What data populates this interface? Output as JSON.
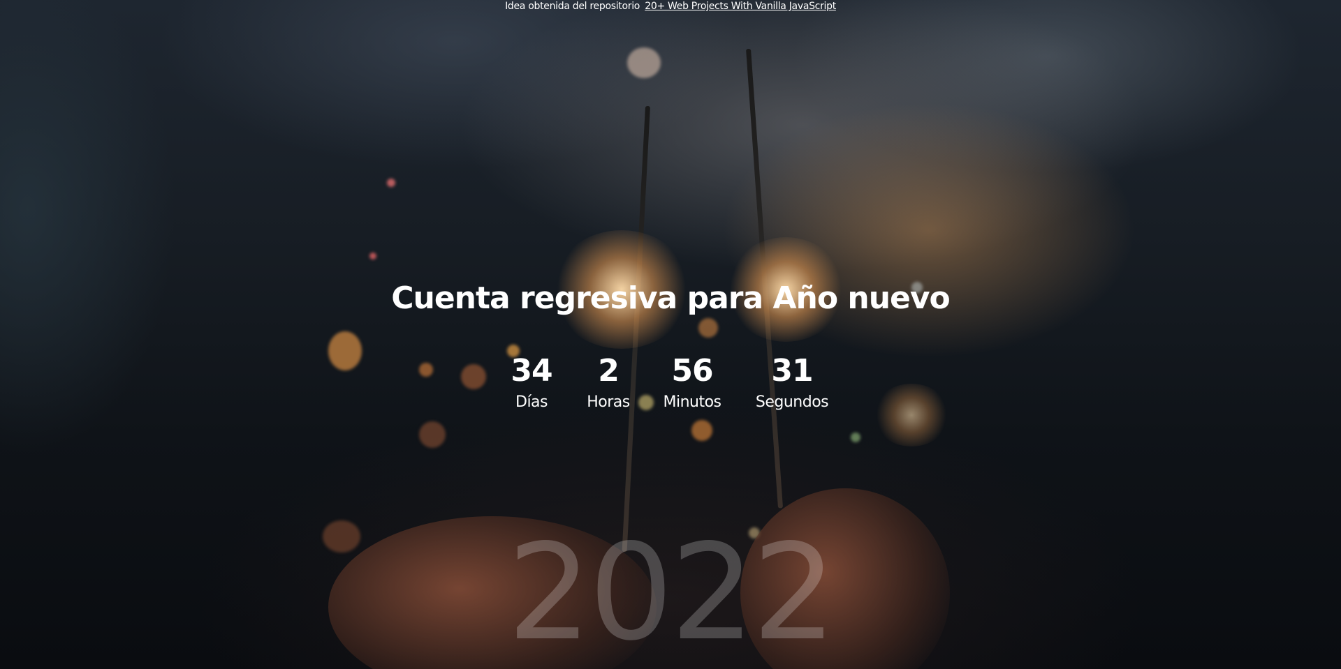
{
  "attribution": {
    "prefix": "Idea obtenida del repositorio",
    "link_text": "20+ Web Projects With Vanilla JavaScript"
  },
  "title": "Cuenta regresiva para Año nuevo",
  "countdown": {
    "days": {
      "value": "34",
      "label": "Días"
    },
    "hours": {
      "value": "2",
      "label": "Horas"
    },
    "minutes": {
      "value": "56",
      "label": "Minutos"
    },
    "seconds": {
      "value": "31",
      "label": "Segundos"
    }
  },
  "year": "2022",
  "colors": {
    "text": "#ffffff",
    "year_text": "rgba(255,255,255,0.22)",
    "background_dark": "#0b0e12"
  }
}
